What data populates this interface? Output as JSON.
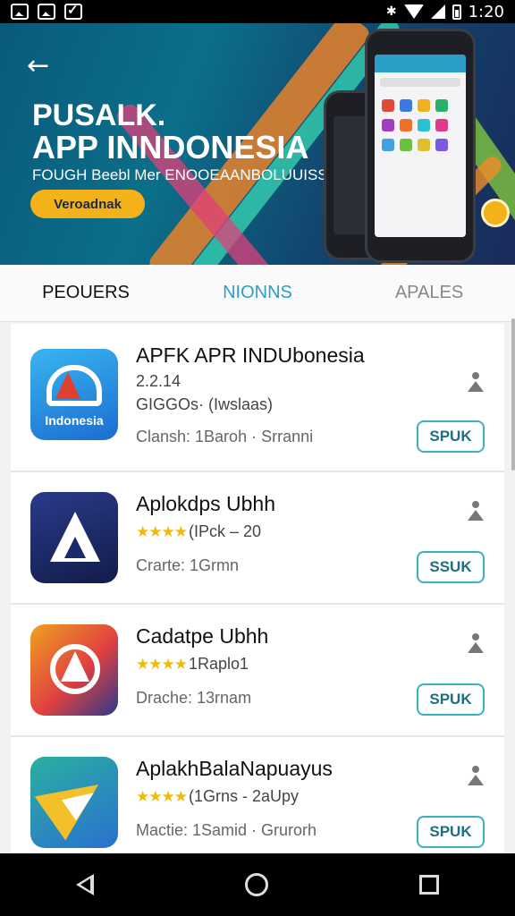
{
  "status_bar": {
    "time": "1:20"
  },
  "banner": {
    "title_line1": "PUSALK.",
    "title_line2": "APP INNDONESIA",
    "subtitle": "FOUGH Beebl Mer ENOOEAANBOLUUISS",
    "cta_label": "Veroadnak"
  },
  "tabs": [
    {
      "label": "PEOUERS"
    },
    {
      "label": "NIONNS"
    },
    {
      "label": "APALES"
    }
  ],
  "apps": [
    {
      "name": "APFK APR INDUbonesia",
      "meta_line1": "2.2.14",
      "meta_line2": "GIGGOs· (Iwslaas)",
      "size_line": "Clansh: 1Baroh · Srranni",
      "install_label": "SPUK",
      "icon_text": "Indonesia",
      "rating_stars": ""
    },
    {
      "name": "Aplokdps Ubhh",
      "meta_line2": "(IPck – 20",
      "size_line": "Crarte: 1Grmn",
      "install_label": "SSUK",
      "rating_stars": "★★★★"
    },
    {
      "name": "Cadatpe Ubhh",
      "meta_line2": "1Raplo1",
      "size_line": "Drache: 13rnam",
      "install_label": "SPUK",
      "rating_stars": "★★★★"
    },
    {
      "name": "AplakhBalaNapuayus",
      "meta_line2": "(1Grns - 2aUpy",
      "size_line": "Mactie: 1Samid · Grurorh",
      "install_label": "SPUK",
      "rating_stars": "★★★★"
    }
  ],
  "colors": {
    "accent": "#2a9ec9",
    "cta": "#f4b21a",
    "star": "#f0b90b",
    "install_border": "#3ab0c9"
  },
  "icons": [
    "back-arrow-icon",
    "wifi-icon",
    "signal-icon",
    "battery-icon",
    "download-person-icon",
    "nav-back-icon",
    "nav-home-icon",
    "nav-recent-icon"
  ]
}
